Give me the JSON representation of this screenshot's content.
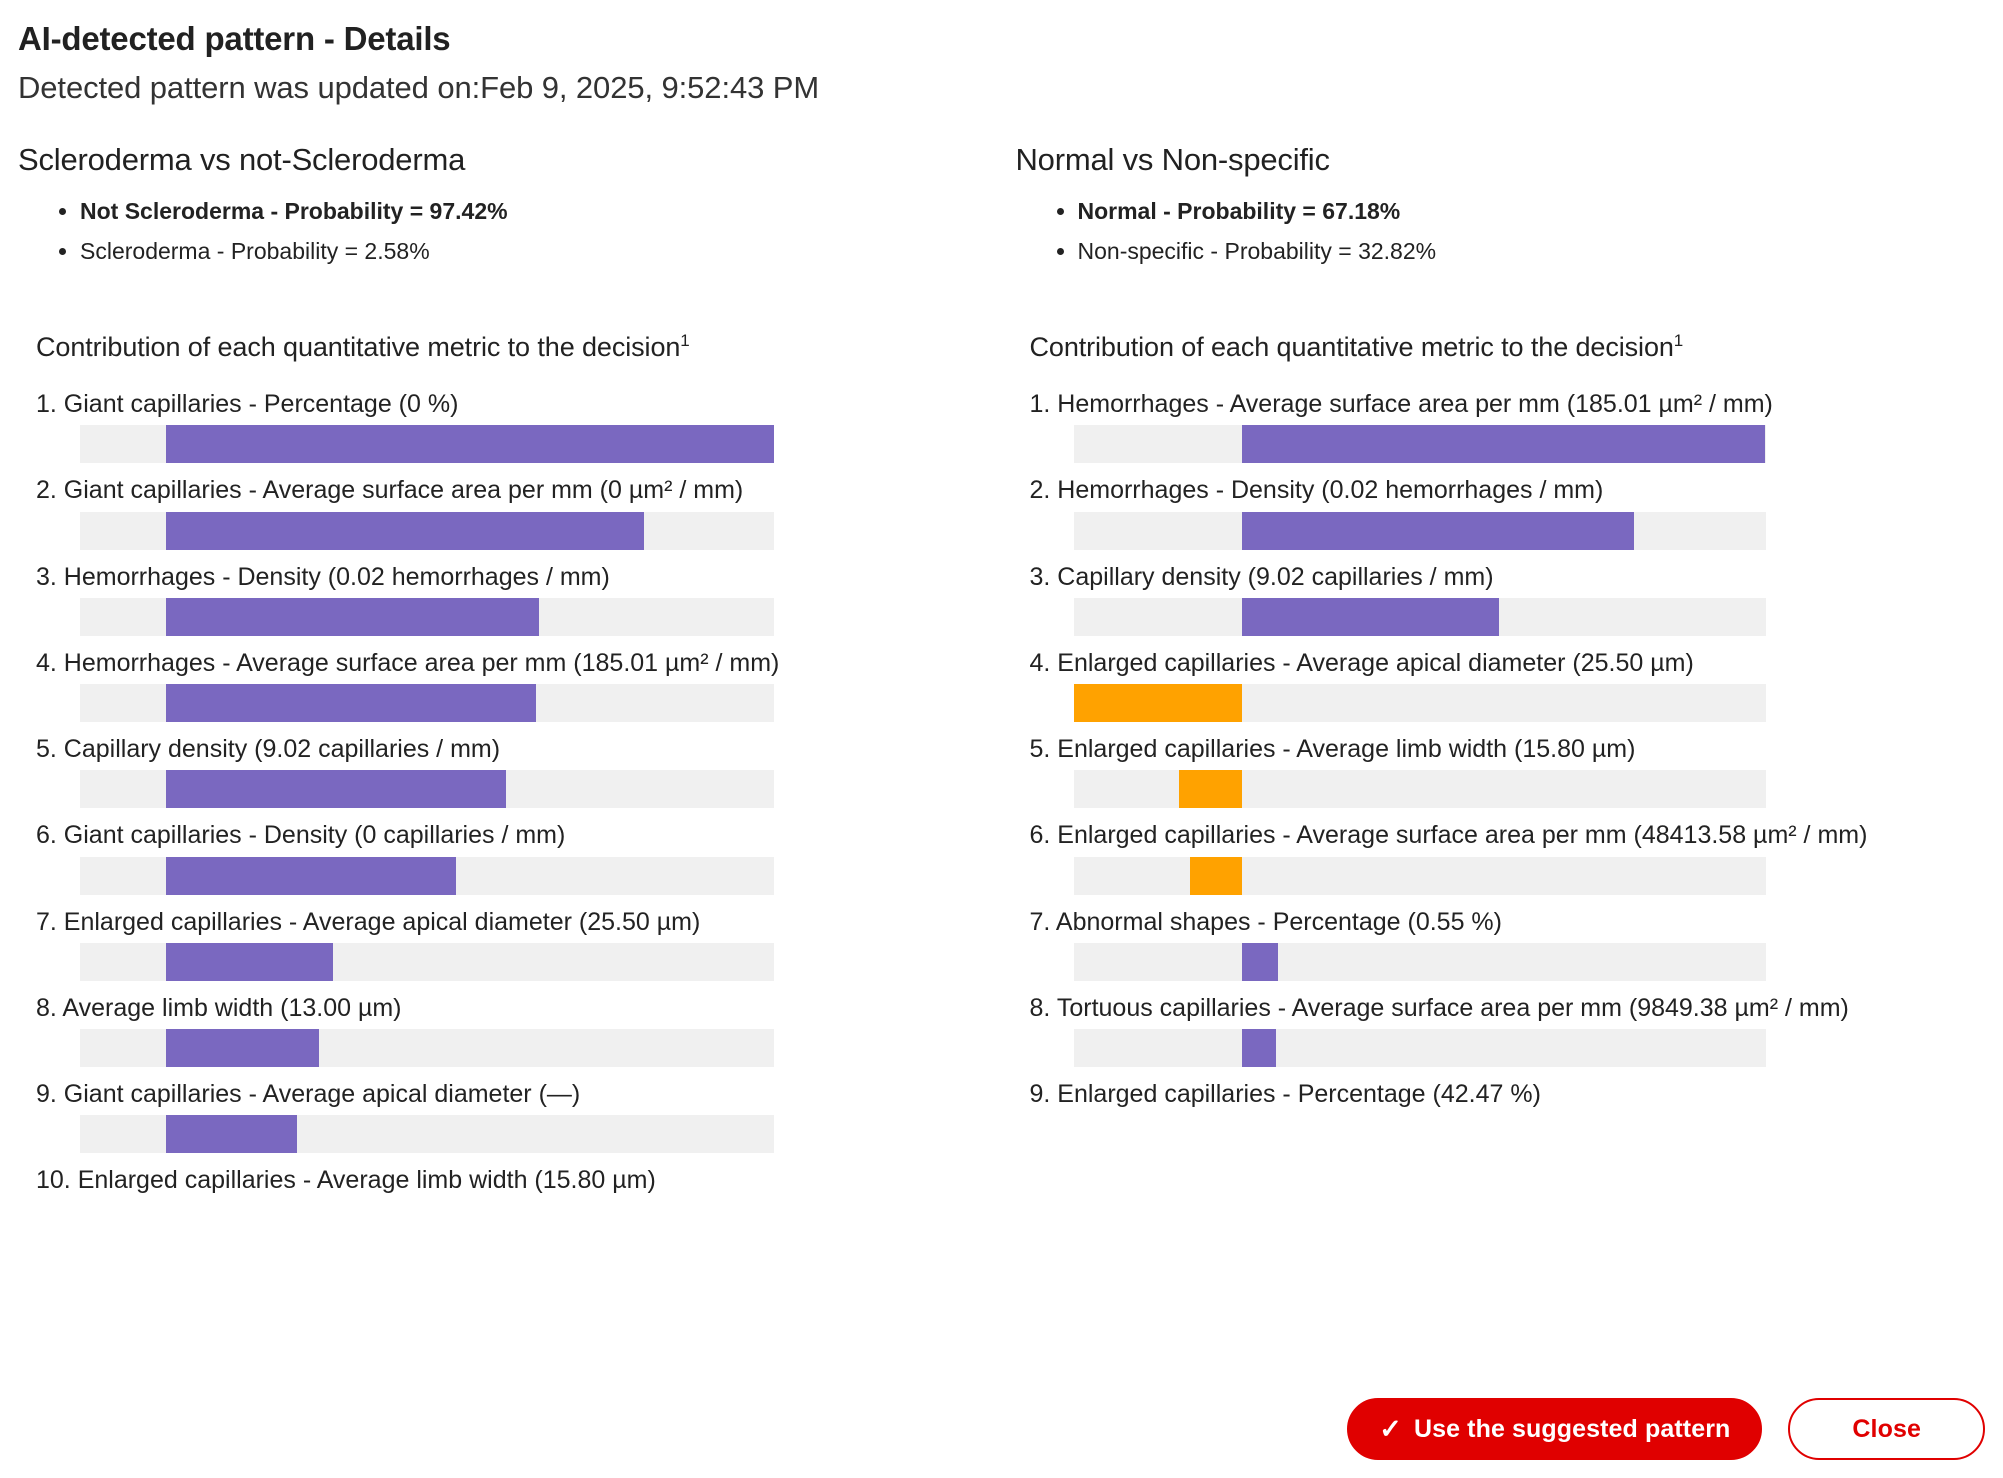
{
  "dialog": {
    "title": "AI-detected pattern - Details",
    "updated_label": "Detected pattern was updated on:",
    "updated_value": "Feb 9, 2025, 9:52:43 PM"
  },
  "left": {
    "title": "Scleroderma vs not-Scleroderma",
    "probabilities": [
      {
        "label": "Not Scleroderma - Probability = 97.42%",
        "primary": true
      },
      {
        "label": "Scleroderma - Probability = 2.58%",
        "primary": false
      }
    ],
    "contribution_title": "Contribution of each quantitative metric to the decision",
    "contribution_footnote_marker": "1",
    "metrics": [
      {
        "index": "1.",
        "label": "Giant capillaries - Percentage (0 %)"
      },
      {
        "index": "2.",
        "label": "Giant capillaries - Average surface area per mm (0 µm² / mm)"
      },
      {
        "index": "3.",
        "label": "Hemorrhages - Density (0.02 hemorrhages / mm)"
      },
      {
        "index": "4.",
        "label": "Hemorrhages - Average surface area per mm (185.01 µm² / mm)"
      },
      {
        "index": "5.",
        "label": "Capillary density (9.02 capillaries / mm)"
      },
      {
        "index": "6.",
        "label": "Giant capillaries - Density (0 capillaries / mm)"
      },
      {
        "index": "7.",
        "label": "Enlarged capillaries - Average apical diameter (25.50 µm)"
      },
      {
        "index": "8.",
        "label": "Average limb width (13.00 µm)"
      },
      {
        "index": "9.",
        "label": "Giant capillaries - Average apical diameter (—)"
      },
      {
        "index": "10.",
        "label": "Enlarged capillaries - Average limb width (15.80 µm)"
      }
    ]
  },
  "right": {
    "title": "Normal vs Non-specific",
    "probabilities": [
      {
        "label": "Normal - Probability = 67.18%",
        "primary": true
      },
      {
        "label": "Non-specific - Probability = 32.82%",
        "primary": false
      }
    ],
    "contribution_title": "Contribution of each quantitative metric to the decision",
    "contribution_footnote_marker": "1",
    "metrics": [
      {
        "index": "1.",
        "label": "Hemorrhages - Average surface area per mm (185.01 µm² / mm)"
      },
      {
        "index": "2.",
        "label": "Hemorrhages - Density (0.02 hemorrhages / mm)"
      },
      {
        "index": "3.",
        "label": "Capillary density (9.02 capillaries / mm)"
      },
      {
        "index": "4.",
        "label": "Enlarged capillaries - Average apical diameter (25.50 µm)"
      },
      {
        "index": "5.",
        "label": "Enlarged capillaries - Average limb width (15.80 µm)"
      },
      {
        "index": "6.",
        "label": "Enlarged capillaries - Average surface area per mm (48413.58 µm² / mm)"
      },
      {
        "index": "7.",
        "label": "Abnormal shapes - Percentage (0.55 %)"
      },
      {
        "index": "8.",
        "label": "Tortuous capillaries - Average surface area per mm (9849.38 µm² / mm)"
      },
      {
        "index": "9.",
        "label": "Enlarged capillaries - Percentage (42.47 %)"
      }
    ]
  },
  "footer": {
    "primary_label": "Use the suggested pattern",
    "primary_icon": "check-icon",
    "secondary_label": "Close"
  },
  "colors": {
    "positive_bar": "#7a68c0",
    "negative_bar": "#ffa200",
    "bar_track": "#f0f0f0",
    "accent_red": "#e00000",
    "text": "#222222"
  },
  "chart_data": [
    {
      "type": "bar",
      "title": "Contribution of each quantitative metric to the decision",
      "subtitle": "Scleroderma vs not-Scleroderma",
      "orientation": "horizontal",
      "baseline_fraction": 0.124,
      "positive_color": "#7a68c0",
      "negative_color": "#ffa200",
      "categories": [
        "Giant capillaries - Percentage (0 %)",
        "Giant capillaries - Average surface area per mm (0 µm² / mm)",
        "Hemorrhages - Density (0.02 hemorrhages / mm)",
        "Hemorrhages - Average surface area per mm (185.01 µm² / mm)",
        "Capillary density (9.02 capillaries / mm)",
        "Giant capillaries - Density (0 capillaries / mm)",
        "Enlarged capillaries - Average apical diameter (25.50 µm)",
        "Average limb width (13.00 µm)",
        "Giant capillaries - Average apical diameter (—)",
        "Enlarged capillaries - Average limb width (15.80 µm)"
      ],
      "values": [
        0.876,
        0.688,
        0.537,
        0.533,
        0.49,
        0.418,
        0.241,
        0.22,
        0.188,
        null
      ],
      "signs": [
        "positive",
        "positive",
        "positive",
        "positive",
        "positive",
        "positive",
        "positive",
        "positive",
        "positive",
        null
      ],
      "xlabel": "",
      "ylabel": "",
      "grid": false,
      "legend": "none"
    },
    {
      "type": "bar",
      "title": "Contribution of each quantitative metric to the decision",
      "subtitle": "Normal vs Non-specific",
      "orientation": "horizontal",
      "baseline_fraction": 0.243,
      "positive_color": "#7a68c0",
      "negative_color": "#ffa200",
      "categories": [
        "Hemorrhages - Average surface area per mm (185.01 µm² / mm)",
        "Hemorrhages - Density (0.02 hemorrhages / mm)",
        "Capillary density (9.02 capillaries / mm)",
        "Enlarged capillaries - Average apical diameter (25.50 µm)",
        "Enlarged capillaries - Average limb width (15.80 µm)",
        "Enlarged capillaries - Average surface area per mm (48413.58 µm² / mm)",
        "Abnormal shapes - Percentage (0.55 %)",
        "Tortuous capillaries - Average surface area per mm (9849.38 µm² / mm)",
        "Enlarged capillaries - Percentage (42.47 %)"
      ],
      "values": [
        0.757,
        0.567,
        0.372,
        -0.243,
        -0.09,
        -0.075,
        0.053,
        0.05,
        null
      ],
      "signs": [
        "positive",
        "positive",
        "positive",
        "negative",
        "negative",
        "negative",
        "positive",
        "positive",
        null
      ],
      "xlabel": "",
      "ylabel": "",
      "grid": false,
      "legend": "none"
    }
  ]
}
